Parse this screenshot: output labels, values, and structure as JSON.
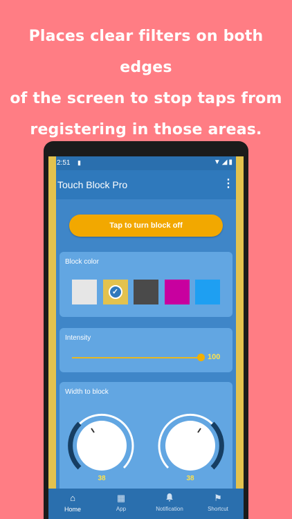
{
  "headline": {
    "line1": "Places clear filters on both edges",
    "line2": "of the screen to stop taps from",
    "line3": "registering in those areas."
  },
  "colors": {
    "background": "#ff7d84",
    "edge_filter": "#e3c24e",
    "app_blue": "#3f86c8",
    "accent": "#f2a800"
  },
  "statusbar": {
    "time": "2:51",
    "icons": [
      "sim-icon",
      "wifi-icon",
      "signal-icon",
      "battery-icon"
    ]
  },
  "appbar": {
    "title": "Touch Block Pro",
    "menu_icon": "more-vert-icon",
    "menu_glyph": "⋮"
  },
  "toggle_button": {
    "label": "Tap to turn block off"
  },
  "block_color": {
    "label": "Block color",
    "swatches": [
      "#e6e6e6",
      "#e3c24e",
      "#4a4a4a",
      "#c8009f",
      "#1e9ff2"
    ],
    "selected_index": 1,
    "check_glyph": "✓"
  },
  "intensity": {
    "label": "Intensity",
    "value": "100",
    "fraction": 1.0
  },
  "width_to_block": {
    "label": "Width to block",
    "left_value": "38",
    "right_value": "38"
  },
  "navbar": {
    "items": [
      {
        "label": "Home",
        "icon": "home-icon",
        "glyph": "⌂",
        "active": true
      },
      {
        "label": "App",
        "icon": "apps-grid-icon",
        "glyph": "▦",
        "active": false
      },
      {
        "label": "Notification",
        "icon": "bell-icon",
        "glyph": "🔔",
        "active": false
      },
      {
        "label": "Shortcut",
        "icon": "flag-icon",
        "glyph": "⚑",
        "active": false
      }
    ]
  }
}
